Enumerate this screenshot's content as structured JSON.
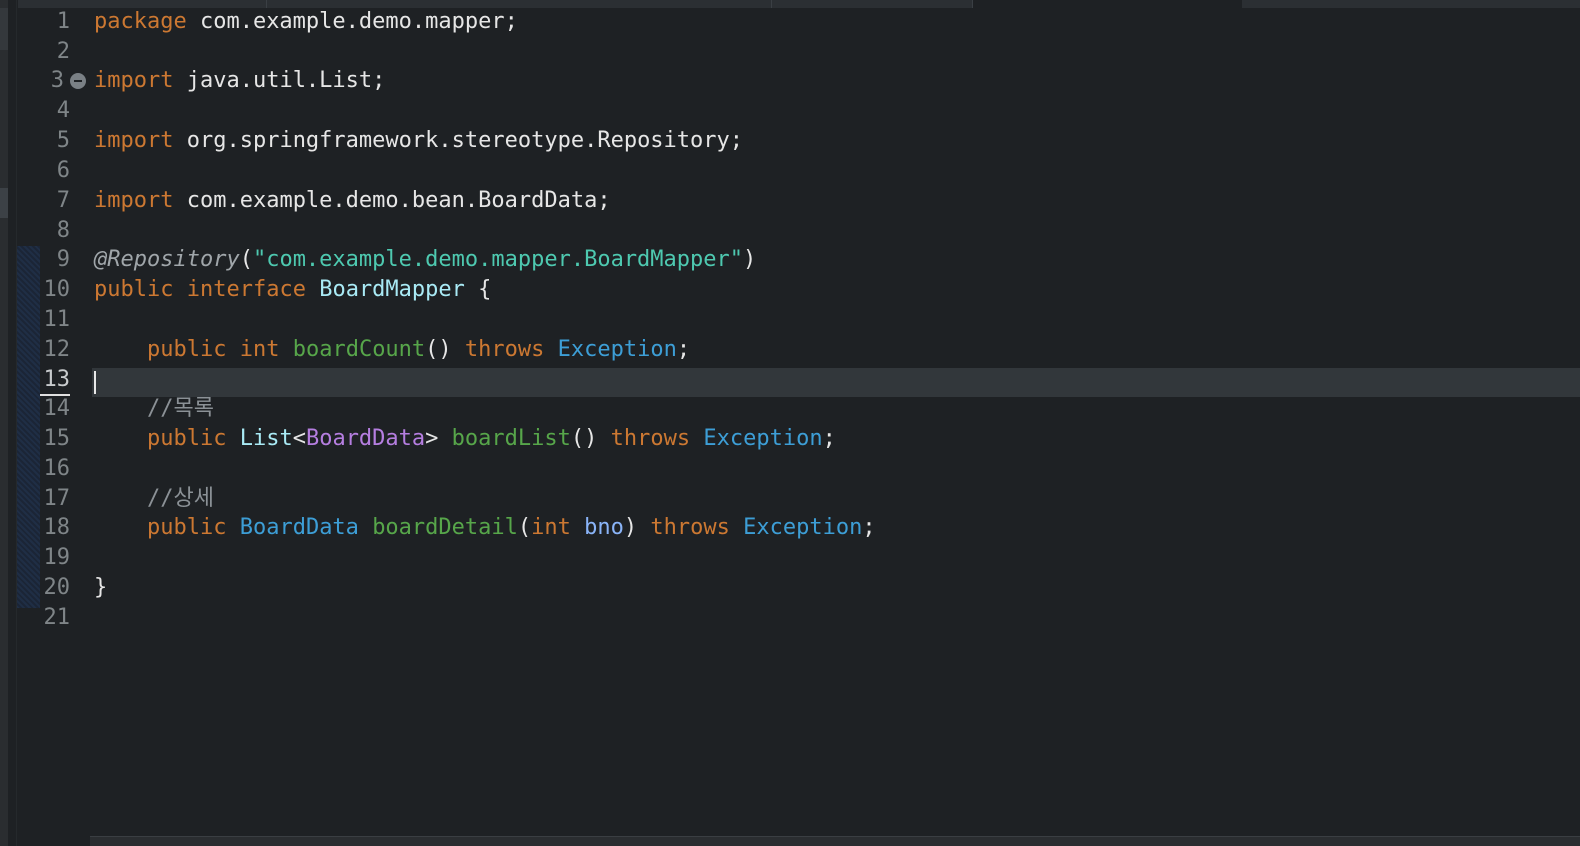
{
  "editor": {
    "line_numbers": [
      "1",
      "2",
      "3",
      "4",
      "5",
      "6",
      "7",
      "8",
      "9",
      "10",
      "11",
      "12",
      "13",
      "14",
      "15",
      "16",
      "17",
      "18",
      "19",
      "20",
      "21"
    ],
    "active_line": "13",
    "code": {
      "l1": {
        "kw": "package",
        "rest": " com.example.demo.mapper;"
      },
      "l3": {
        "kw": "import",
        "rest": " java.util.List;"
      },
      "l5": {
        "kw": "import",
        "rest": " org.springframework.stereotype.Repository;"
      },
      "l7": {
        "kw": "import",
        "rest": " com.example.demo.bean.BoardData;"
      },
      "l9": {
        "annotation": "@Repository",
        "open": "(",
        "string": "\"com.example.demo.mapper.BoardMapper\"",
        "close": ")"
      },
      "l10": {
        "kw1": "public",
        "kw2": "interface",
        "name": "BoardMapper",
        "brace": " {"
      },
      "l12": {
        "kw1": "public",
        "kw2": "int",
        "fn": "boardCount",
        "parens": "()",
        "throws": "throws",
        "exc": "Exception",
        "semi": ";"
      },
      "l14": {
        "comment": "//목록"
      },
      "l15": {
        "kw1": "public",
        "type": "List",
        "lt": "<",
        "generic": "BoardData",
        "gt": ">",
        "fn": "boardList",
        "parens": "()",
        "throws": "throws",
        "exc": "Exception",
        "semi": ";"
      },
      "l17": {
        "comment": "//상세"
      },
      "l18": {
        "kw1": "public",
        "type": "BoardData",
        "fn": "boardDetail",
        "open": "(",
        "ptype": "int",
        "pname": "bno",
        "close": ")",
        "throws": "throws",
        "exc": "Exception",
        "semi": ";"
      },
      "l20": {
        "brace": "}"
      }
    }
  },
  "colors": {
    "background": "#1e2124",
    "keyword": "#cc7832",
    "string": "#4ec9b0",
    "function": "#57a64a",
    "type": "#3d9ed6",
    "generic": "#b57ee0",
    "comment": "#8b9196"
  },
  "icons": {
    "fold": "fold-collapse-icon"
  }
}
